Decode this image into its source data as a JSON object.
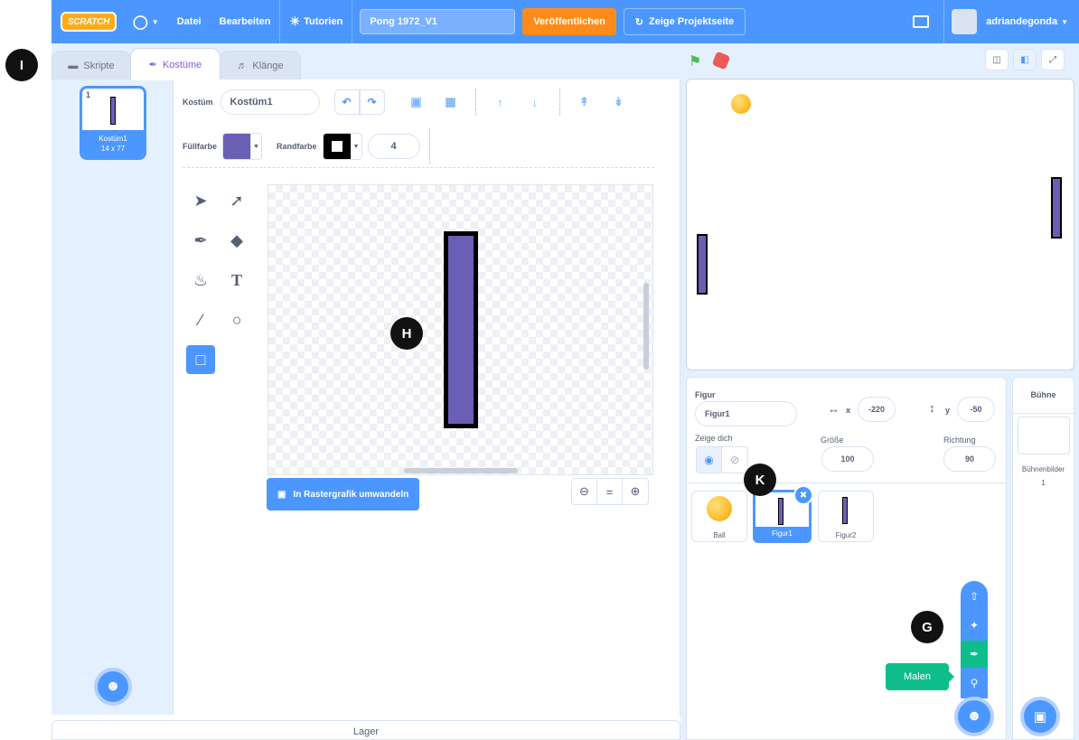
{
  "menubar": {
    "logo": "SCRATCH",
    "language_icon": "globe-icon",
    "file": "Datei",
    "edit": "Bearbeiten",
    "tutorials": "Tutorien",
    "project_title": "Pong 1972_V1",
    "publish": "Veröffentlichen",
    "project_page": "Zeige Projektseite",
    "username": "adriandegonda"
  },
  "tabs": {
    "code": "Skripte",
    "costumes": "Kostüme",
    "sounds": "Klänge"
  },
  "costume_list": {
    "items": [
      {
        "number": "1",
        "name": "Kostüm1",
        "size": "14 x 77"
      }
    ]
  },
  "paint": {
    "costume_label": "Kostüm",
    "costume_name": "Kostüm1",
    "fill_label": "Füllfarbe",
    "outline_label": "Randfarbe",
    "outline_width": "4",
    "fill_color": "#6b5fb5",
    "outline_color": "#000000",
    "convert_button": "In Rastergrafik umwandeln"
  },
  "lager": "Lager",
  "sprite_info": {
    "sprite_label": "Figur",
    "sprite_name": "Figur1",
    "x_label": "x",
    "x_value": "-220",
    "y_label": "y",
    "y_value": "-50",
    "show_label": "Zeige dich",
    "size_label": "Größe",
    "size_value": "100",
    "direction_label": "Richtung",
    "direction_value": "90"
  },
  "sprites": [
    {
      "name": "Ball"
    },
    {
      "name": "Figur1"
    },
    {
      "name": "Figur2"
    }
  ],
  "tooltip": "Malen",
  "stage_pane": {
    "header": "Bühne",
    "backdrops_label": "Bühnenbilder",
    "backdrops_count": "1"
  },
  "markers": {
    "i": "I",
    "h": "H",
    "k": "K",
    "g": "G"
  }
}
